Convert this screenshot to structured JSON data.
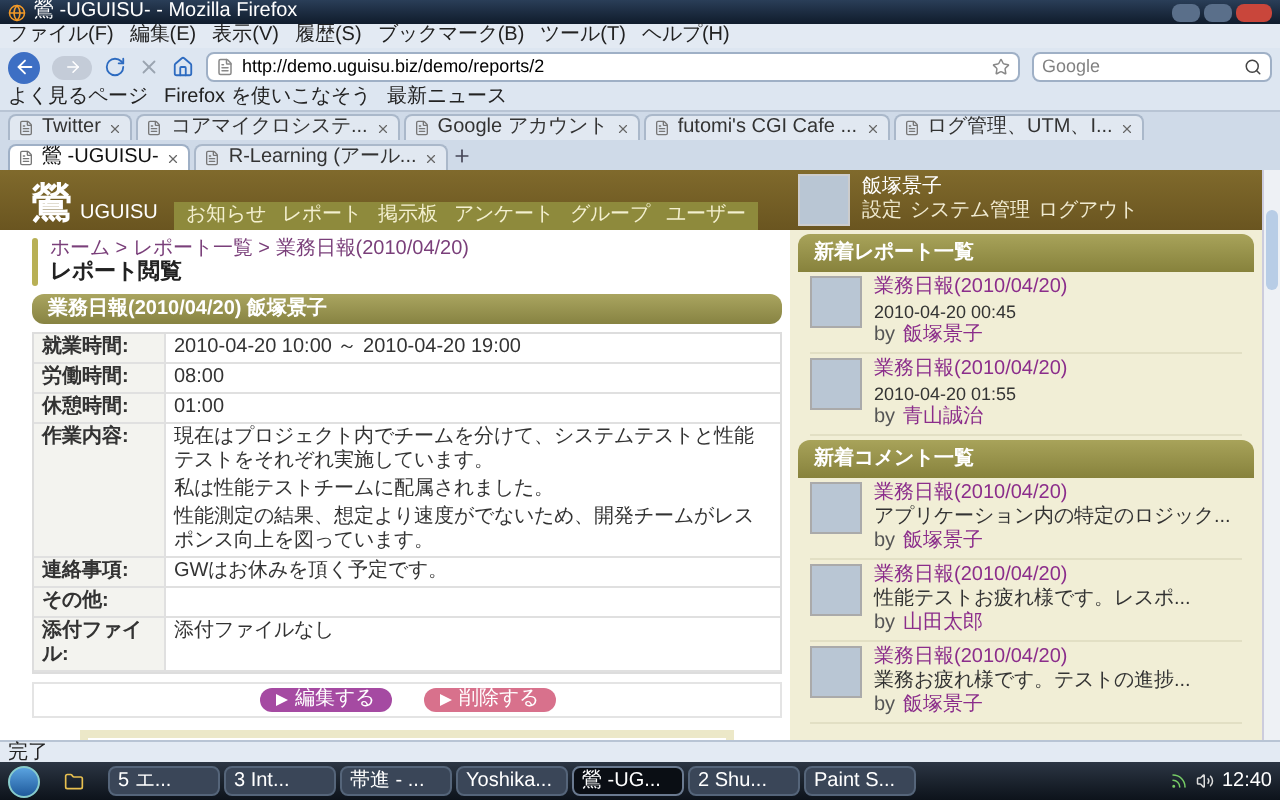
{
  "window": {
    "title": "鶯 -UGUISU- - Mozilla Firefox"
  },
  "menu": [
    "ファイル(F)",
    "編集(E)",
    "表示(V)",
    "履歴(S)",
    "ブックマーク(B)",
    "ツール(T)",
    "ヘルプ(H)"
  ],
  "address_bar": {
    "value": "http://demo.uguisu.biz/demo/reports/2"
  },
  "search": {
    "placeholder": "Google"
  },
  "bookmarks": [
    "よく見るページ",
    "Firefox を使いこなそう",
    "最新ニュース"
  ],
  "tabs": [
    {
      "label": "Twitter",
      "selected": false
    },
    {
      "label": "コアマイクロシステ...",
      "selected": false
    },
    {
      "label": "Google アカウント",
      "selected": false
    },
    {
      "label": "futomi's CGI Cafe ...",
      "selected": false
    },
    {
      "label": "ログ管理、UTM、I...",
      "selected": false
    },
    {
      "label": "鶯 -UGUISU-",
      "selected": true
    },
    {
      "label": "R-Learning (アール...",
      "selected": false
    }
  ],
  "site": {
    "logo": "鶯",
    "logo_sub": "UGUISU",
    "nav": [
      "お知らせ",
      "レポート",
      "掲示板",
      "アンケート",
      "グループ",
      "ユーザー"
    ],
    "user": {
      "name": "飯塚景子",
      "links": [
        "設定",
        "システム管理",
        "ログアウト"
      ]
    }
  },
  "breadcrumb": "ホーム > レポート一覧 > 業務日報(2010/04/20)",
  "page_title": "レポート閲覧",
  "report": {
    "title": "業務日報(2010/04/20) 飯塚景子",
    "fields": [
      {
        "label": "就業時間:",
        "paragraphs": [
          "2010-04-20 10:00 ～ 2010-04-20 19:00"
        ]
      },
      {
        "label": "労働時間:",
        "paragraphs": [
          "08:00"
        ]
      },
      {
        "label": "休憩時間:",
        "paragraphs": [
          "01:00"
        ]
      },
      {
        "label": "作業内容:",
        "paragraphs": [
          "現在はプロジェクト内でチームを分けて、システムテストと性能テストをそれぞれ実施しています。",
          "私は性能テストチームに配属されました。",
          "性能測定の結果、想定より速度がでないため、開発チームがレスポンス向上を図っています。"
        ]
      },
      {
        "label": "連絡事項:",
        "paragraphs": [
          "GWはお休みを頂く予定です。"
        ]
      },
      {
        "label": "その他:"
      },
      {
        "label": "添付ファイル:",
        "paragraphs": [
          "添付ファイルなし"
        ]
      }
    ]
  },
  "buttons": [
    {
      "label": "編集する",
      "kind": "edit"
    },
    {
      "label": "削除する",
      "kind": "delete"
    }
  ],
  "recent_reports": {
    "title": "新着レポート一覧",
    "items": [
      {
        "title": "業務日報(2010/04/20)",
        "date": "2010-04-20 00:45",
        "by_prefix": "by",
        "by": "飯塚景子"
      },
      {
        "title": "業務日報(2010/04/20)",
        "date": "2010-04-20 01:55",
        "by_prefix": "by",
        "by": "青山誠治"
      }
    ]
  },
  "recent_comments": {
    "title": "新着コメント一覧",
    "items": [
      {
        "title": "業務日報(2010/04/20)",
        "excerpt": "アプリケーション内の特定のロジック...",
        "by_prefix": "by",
        "by": "飯塚景子"
      },
      {
        "title": "業務日報(2010/04/20)",
        "excerpt": "性能テストお疲れ様です。レスポ...",
        "by_prefix": "by",
        "by": "山田太郎"
      },
      {
        "title": "業務日報(2010/04/20)",
        "excerpt": "業務お疲れ様です。テストの進捗...",
        "by_prefix": "by",
        "by": "飯塚景子"
      }
    ]
  },
  "status_bar": "完了",
  "taskbar": {
    "items": [
      {
        "label": "5 エ...",
        "selected": false
      },
      {
        "label": "3 Int...",
        "selected": false
      },
      {
        "label": "帯進 - ...",
        "selected": false
      },
      {
        "label": "Yoshika...",
        "selected": false
      },
      {
        "label": "鶯 -UG...",
        "selected": true
      },
      {
        "label": "2 Shu...",
        "selected": false
      },
      {
        "label": "Paint S...",
        "selected": false
      }
    ],
    "clock": "12:40"
  }
}
